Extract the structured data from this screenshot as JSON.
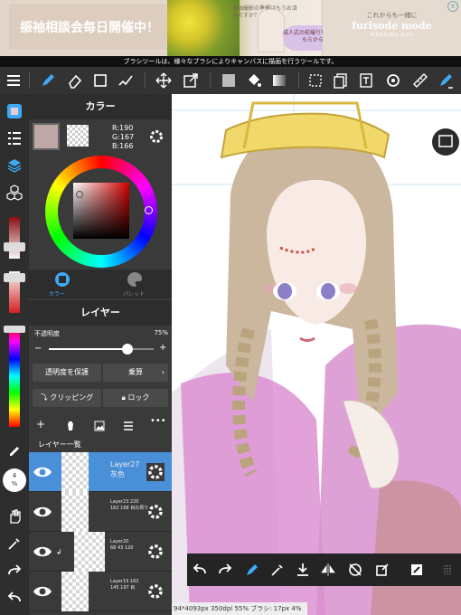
{
  "ad": {
    "left_text": "振袖相談会毎日開催中！",
    "middle_text": "振袖撮影の準備はもうお済みですか？",
    "bubble_text": "成人式の前撮り写真はこちらから",
    "right_sub": "これからも一緒に",
    "right_title": "furisode mode",
    "right_brand": "WEDDING BOX",
    "close": "x"
  },
  "tooltip": "ブラシツールは、様々なブラシによりキャンバスに描画を行うツールです。",
  "color_panel": {
    "title": "カラー",
    "r": "R:190",
    "g": "G:167",
    "b": "B:166",
    "primary_color": "#bea7a6",
    "tab_color": "カラー",
    "tab_palette": "パレット"
  },
  "layer_panel": {
    "title": "レイヤー",
    "opacity_label": "不透明度",
    "opacity_value": "75%",
    "opacity_fraction": 0.75,
    "protect_alpha": "透明度を保護",
    "blend_mode": "乗算",
    "clipping": "クリッピング",
    "lock": "ロック",
    "list_title": "レイヤー一覧",
    "layers": [
      {
        "name": "Layer27",
        "sub": "灰色"
      },
      {
        "name": "Layer23 220",
        "sub": "162 168 目の周り"
      },
      {
        "name": "Layer20",
        "sub": "68 43 120"
      },
      {
        "name": "Layer19 162",
        "sub": "145 197 目"
      }
    ]
  },
  "brush_size_label": "4",
  "brush_size_unit": "%",
  "status_text": "94*4093px 350dpi 55% ブラシ: 17px 4%"
}
